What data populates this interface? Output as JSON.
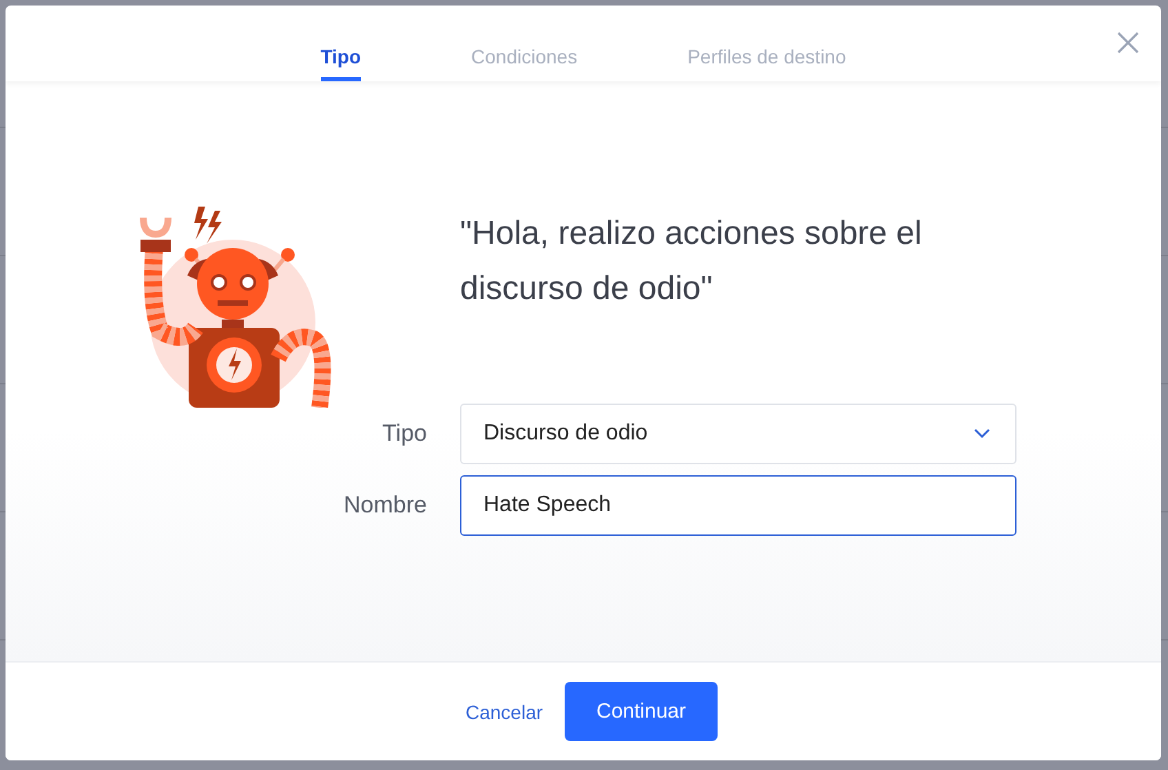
{
  "tabs": [
    {
      "label": "Tipo",
      "selected": true
    },
    {
      "label": "Condiciones",
      "selected": false
    },
    {
      "label": "Perfiles de destino",
      "selected": false
    }
  ],
  "heading": "\"Hola, realizo acciones sobre el discurso de odio\"",
  "fields": [
    {
      "kind": "select",
      "label": "Tipo",
      "value": "Discurso de odio",
      "focused": false
    },
    {
      "kind": "text",
      "label": "Nombre",
      "value": "Hate Speech",
      "focused": true
    }
  ],
  "buttons": [
    {
      "kind": "link",
      "label": "Cancelar"
    },
    {
      "kind": "primary",
      "label": "Continuar"
    }
  ]
}
